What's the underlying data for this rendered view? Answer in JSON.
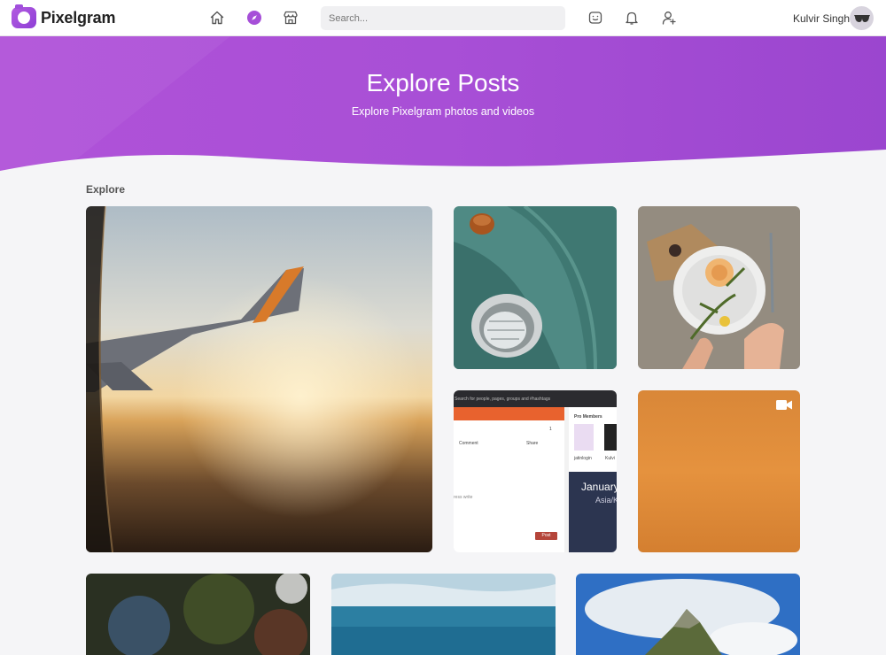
{
  "app": {
    "name": "Pixelgram",
    "user": "Kulvir Singh",
    "accent": "#a64fd8"
  },
  "nav": {
    "icons": [
      "home-icon",
      "explore-icon",
      "store-icon",
      "messenger-icon",
      "bell-icon",
      "add-user-icon"
    ],
    "active": "explore-icon",
    "search_placeholder": "Search..."
  },
  "hero": {
    "title": "Explore Posts",
    "subtitle": "Explore Pixelgram photos and videos"
  },
  "explore": {
    "label": "Explore"
  },
  "tiles": [
    {
      "subject": "airplane wing over sunset landscape"
    },
    {
      "subject": "teal vintage car headlight"
    },
    {
      "subject": "plate with fig and flowers on burlap"
    },
    {
      "subject": "app screenshot"
    },
    {
      "subject": "orange video thumbnail",
      "badge": "video-icon"
    },
    {
      "subject": "blurred bokeh photo"
    },
    {
      "subject": "ocean horizon"
    },
    {
      "subject": "mountain island under clouds"
    }
  ],
  "screenshot_tile": {
    "search_text": "Search for people, pages, groups and #hashtags",
    "comment": "Comment",
    "share": "Share",
    "members_title": "Pro Members",
    "member_1": "jatinlogin",
    "member_2": "Kulvi",
    "input_hint": "ress write",
    "post_button": "Post",
    "count": "1",
    "month": "January",
    "region": "Asia/K"
  }
}
